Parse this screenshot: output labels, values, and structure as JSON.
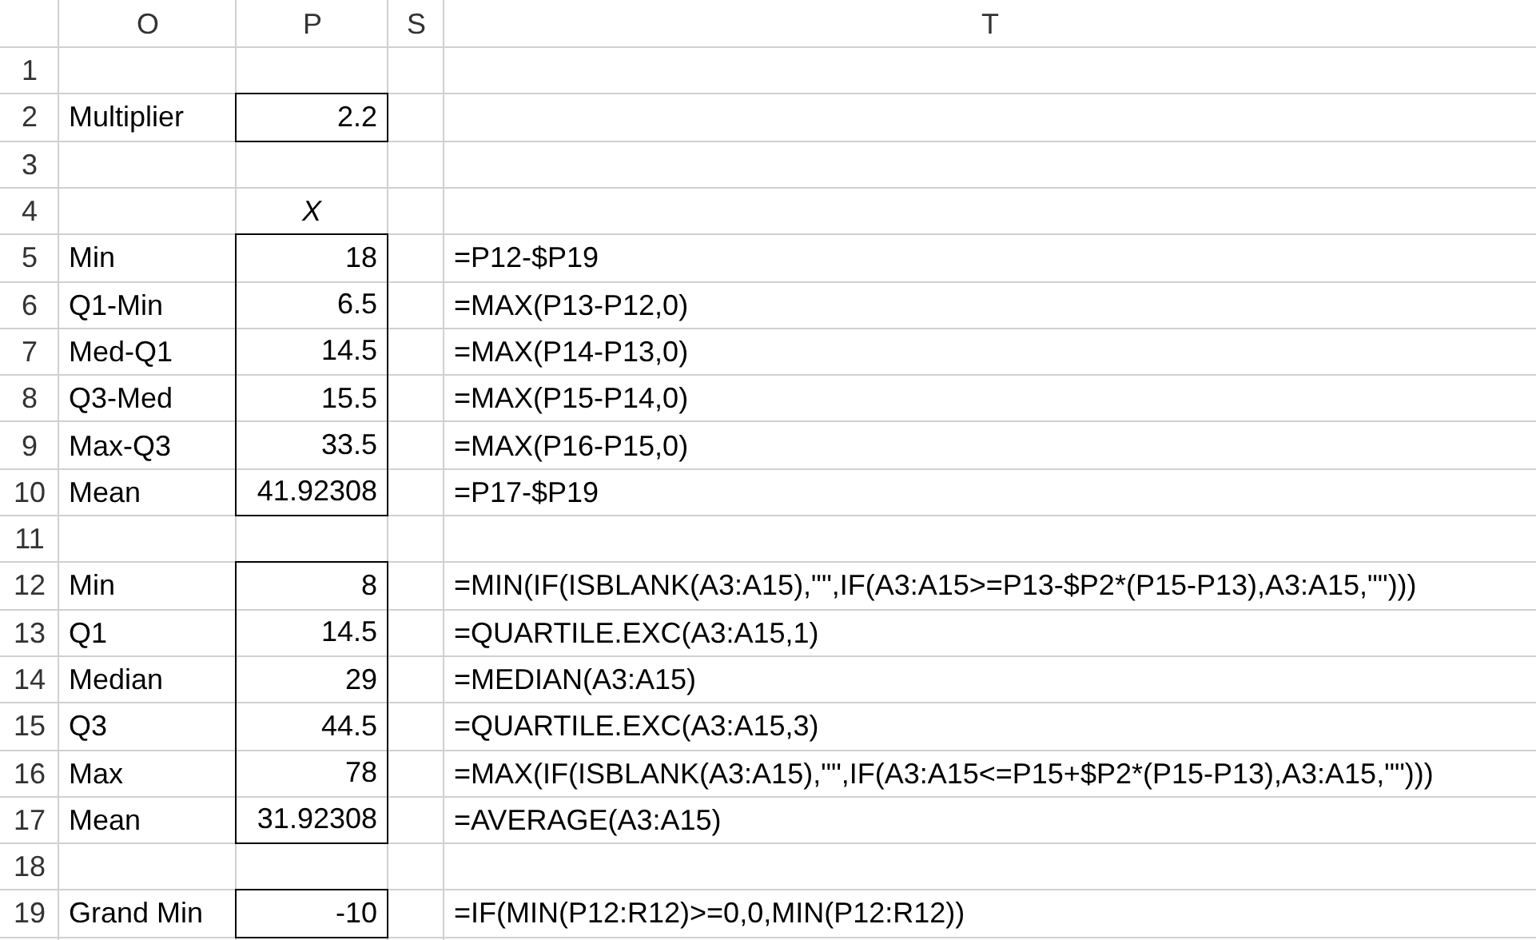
{
  "columns": [
    "O",
    "P",
    "S",
    "T"
  ],
  "rows": [
    {
      "number": "1"
    },
    {
      "number": "2",
      "o": "Multiplier",
      "p": {
        "text": "2.2",
        "kind": "boxsingle"
      }
    },
    {
      "number": "3"
    },
    {
      "number": "4",
      "p": {
        "text": "X",
        "kind": "heading"
      }
    },
    {
      "number": "5",
      "o": "Min",
      "p": {
        "text": "18",
        "kind": "boxtop"
      },
      "t": "=P12-$P19"
    },
    {
      "number": "6",
      "o": "Q1-Min",
      "p": {
        "text": "6.5",
        "kind": "boxmiddle"
      },
      "t": "=MAX(P13-P12,0)"
    },
    {
      "number": "7",
      "o": "Med-Q1",
      "p": {
        "text": "14.5",
        "kind": "boxmiddle"
      },
      "t": "=MAX(P14-P13,0)"
    },
    {
      "number": "8",
      "o": "Q3-Med",
      "p": {
        "text": "15.5",
        "kind": "boxmiddle"
      },
      "t": "=MAX(P15-P14,0)"
    },
    {
      "number": "9",
      "o": "Max-Q3",
      "p": {
        "text": "33.5",
        "kind": "boxmiddle"
      },
      "t": "=MAX(P16-P15,0)"
    },
    {
      "number": "10",
      "o": "Mean",
      "p": {
        "text": "41.92308",
        "kind": "boxbottom"
      },
      "t": "=P17-$P19"
    },
    {
      "number": "11"
    },
    {
      "number": "12",
      "o": "Min",
      "p": {
        "text": "8",
        "kind": "boxtop"
      },
      "t": "=MIN(IF(ISBLANK(A3:A15),\"\",IF(A3:A15>=P13-$P2*(P15-P13),A3:A15,\"\")))"
    },
    {
      "number": "13",
      "o": "Q1",
      "p": {
        "text": "14.5",
        "kind": "boxmiddle"
      },
      "t": "=QUARTILE.EXC(A3:A15,1)"
    },
    {
      "number": "14",
      "o": "Median",
      "p": {
        "text": "29",
        "kind": "boxmiddle"
      },
      "t": "=MEDIAN(A3:A15)"
    },
    {
      "number": "15",
      "o": "Q3",
      "p": {
        "text": "44.5",
        "kind": "boxmiddle"
      },
      "t": "=QUARTILE.EXC(A3:A15,3)"
    },
    {
      "number": "16",
      "o": "Max",
      "p": {
        "text": "78",
        "kind": "boxmiddle"
      },
      "t": "=MAX(IF(ISBLANK(A3:A15),\"\",IF(A3:A15<=P15+$P2*(P15-P13),A3:A15,\"\")))"
    },
    {
      "number": "17",
      "o": "Mean",
      "p": {
        "text": "31.92308",
        "kind": "boxbottom"
      },
      "t": "=AVERAGE(A3:A15)"
    },
    {
      "number": "18"
    },
    {
      "number": "19",
      "o": "Grand Min",
      "p": {
        "text": "-10",
        "kind": "boxsingle"
      },
      "t": "=IF(MIN(P12:R12)>=0,0,MIN(P12:R12))"
    }
  ]
}
